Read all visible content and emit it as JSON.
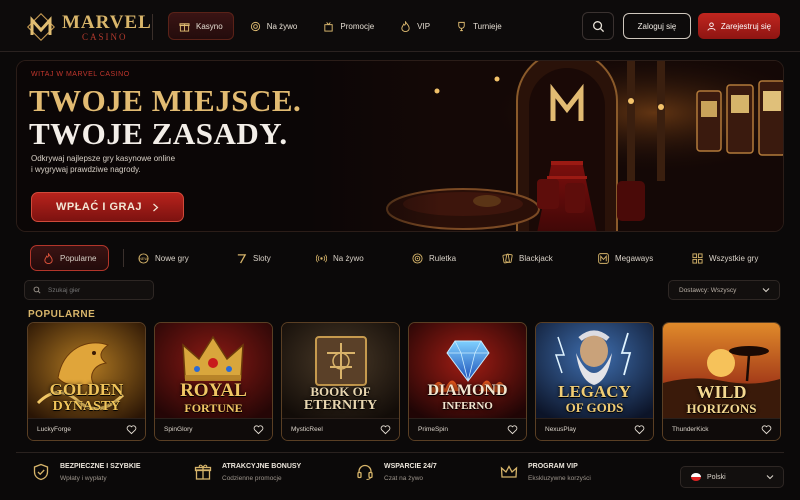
{
  "brand": {
    "name": "MARVEL",
    "sub": "CASINO"
  },
  "nav": [
    {
      "label": "Kasyno",
      "icon": "gift-icon",
      "active": true
    },
    {
      "label": "Na żywo",
      "icon": "chip-icon"
    },
    {
      "label": "Promocje",
      "icon": "present-icon"
    },
    {
      "label": "VIP",
      "icon": "fire-icon"
    },
    {
      "label": "Turnieje",
      "icon": "trophy-icon"
    }
  ],
  "header": {
    "login": "Zaloguj się",
    "register": "Zarejestruj się"
  },
  "hero": {
    "kicker": "WITAJ W MARVEL CASINO",
    "title1": "TWOJE MIEJSCE.",
    "title2": "TWOJE ZASADY.",
    "desc1": "Odkrywaj najlepsze gry kasynowe online",
    "desc2": "i wygrywaj prawdziwe nagrody.",
    "cta": "WPŁAĆ I GRAJ"
  },
  "categories": [
    {
      "label": "Popularne",
      "icon": "fire-icon",
      "active": true
    },
    {
      "label": "Nowe gry",
      "icon": "new-icon"
    },
    {
      "label": "Sloty",
      "icon": "seven-icon"
    },
    {
      "label": "Na żywo",
      "icon": "broadcast-icon"
    },
    {
      "label": "Ruletka",
      "icon": "roulette-icon"
    },
    {
      "label": "Blackjack",
      "icon": "cards-icon"
    },
    {
      "label": "Megaways",
      "icon": "m-icon"
    },
    {
      "label": "Wszystkie gry",
      "icon": "grid-icon"
    }
  ],
  "search": {
    "placeholder": "Szukaj gier"
  },
  "providers": {
    "label": "Dostawcy: Wszyscy"
  },
  "section": {
    "title": "POPULARNE"
  },
  "games": [
    {
      "line1": "GOLDEN",
      "line2": "DYNASTY",
      "provider": "LuckyForge"
    },
    {
      "line1": "ROYAL",
      "line2": "FORTUNE",
      "provider": "SpinGlory"
    },
    {
      "line1": "BOOK OF",
      "line2": "ETERNITY",
      "provider": "MysticReel"
    },
    {
      "line1": "DIAMOND",
      "line2": "INFERNO",
      "provider": "PrimeSpin"
    },
    {
      "line1": "LEGACY",
      "line2": "OF GODS",
      "provider": "NexusPlay"
    },
    {
      "line1": "WILD",
      "line2": "HORIZONS",
      "provider": "ThunderKick"
    }
  ],
  "features": [
    {
      "title": "BEZPIECZNE I SZYBKIE",
      "sub": "Wpłaty i wypłaty",
      "icon": "shield-icon"
    },
    {
      "title": "ATRAKCYJNE BONUSY",
      "sub": "Codzienne promocje",
      "icon": "gift-icon"
    },
    {
      "title": "WSPARCIE 24/7",
      "sub": "Czat na żywo",
      "icon": "headset-icon"
    },
    {
      "title": "PROGRAM VIP",
      "sub": "Ekskluzywne korzyści",
      "icon": "crown-icon"
    }
  ],
  "language": {
    "label": "Polski"
  }
}
